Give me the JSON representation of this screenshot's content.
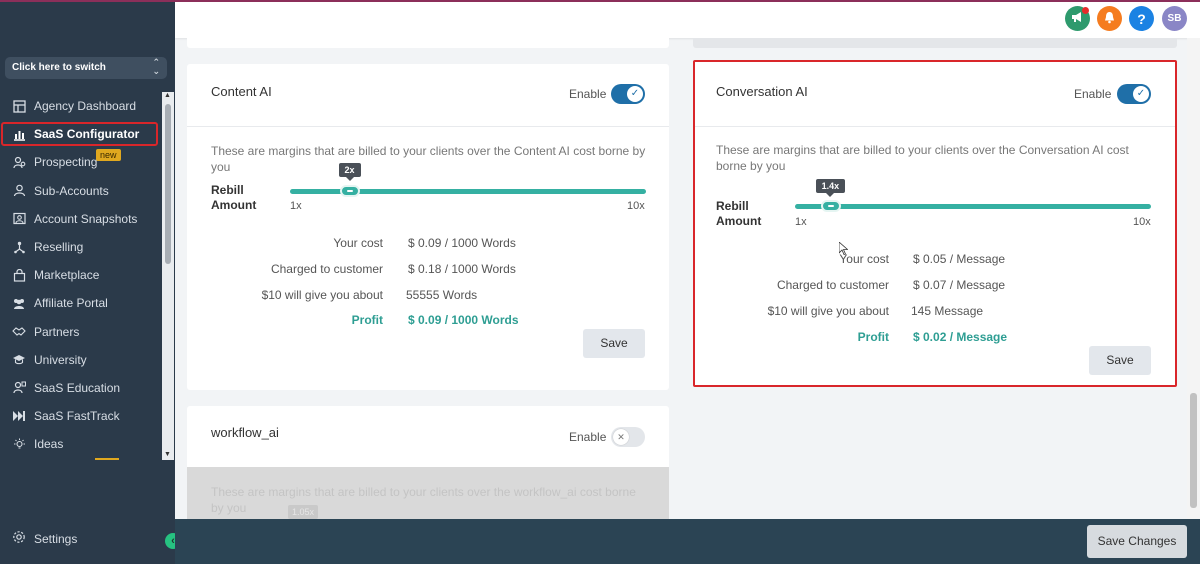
{
  "sidebar": {
    "switcher_label": "Click here to switch",
    "items": [
      {
        "label": "Agency Dashboard",
        "icon": "dashboard-icon"
      },
      {
        "label": "SaaS Configurator",
        "icon": "chart-icon",
        "active": true
      },
      {
        "label": "Prospecting",
        "icon": "person-search-icon",
        "badge": "new"
      },
      {
        "label": "Sub-Accounts",
        "icon": "user-icon"
      },
      {
        "label": "Account Snapshots",
        "icon": "snapshot-icon"
      },
      {
        "label": "Reselling",
        "icon": "reselling-icon"
      },
      {
        "label": "Marketplace",
        "icon": "bag-icon"
      },
      {
        "label": "Affiliate Portal",
        "icon": "users-icon"
      },
      {
        "label": "Partners",
        "icon": "handshake-icon"
      },
      {
        "label": "University",
        "icon": "graduation-icon"
      },
      {
        "label": "SaaS Education",
        "icon": "education-icon"
      },
      {
        "label": "SaaS FastTrack",
        "icon": "fast-forward-icon"
      },
      {
        "label": "Ideas",
        "icon": "lightbulb-icon"
      }
    ],
    "settings_label": "Settings"
  },
  "header": {
    "avatar_initials": "SB",
    "help_glyph": "?"
  },
  "cards": {
    "content_ai": {
      "title": "Content AI",
      "enable_label": "Enable",
      "enabled": true,
      "description": "These are margins that are billed to your clients over the Content AI cost borne by you",
      "rebill_label_1": "Rebill",
      "rebill_label_2": "Amount",
      "slider_value": "2x",
      "slider_fraction": 0.111,
      "min_label": "1x",
      "max_label": "10x",
      "your_cost_label": "Your cost",
      "your_cost_value": "$  0.09 / 1000 Words",
      "charged_label": "Charged to customer",
      "charged_value": "$ 0.18 / 1000 Words",
      "ten_label": "$10 will give you about",
      "ten_value": "55555 Words",
      "profit_label": "Profit",
      "profit_value": "$ 0.09 / 1000 Words",
      "save_label": "Save"
    },
    "conversation_ai": {
      "title": "Conversation AI",
      "enable_label": "Enable",
      "enabled": true,
      "description": "These are margins that are billed to your clients over the Conversation AI cost borne by you",
      "rebill_label_1": "Rebill",
      "rebill_label_2": "Amount",
      "slider_value": "1.4x",
      "slider_fraction": 0.044,
      "min_label": "1x",
      "max_label": "10x",
      "your_cost_label": "Your cost",
      "your_cost_value": "$  0.05 / Message",
      "charged_label": "Charged to customer",
      "charged_value": "$ 0.07 / Message",
      "ten_label": "$10 will give you about",
      "ten_value": "145 Message",
      "profit_label": "Profit",
      "profit_value": "$ 0.02 / Message",
      "save_label": "Save"
    },
    "workflow_ai": {
      "title": "workflow_ai",
      "enable_label": "Enable",
      "enabled": false,
      "description": "These are margins that are billed to your clients over the workflow_ai cost borne by you",
      "slider_value": "1.05x"
    }
  },
  "footer": {
    "save_changes_label": "Save Changes"
  },
  "colors": {
    "sidebar_bg": "#2b3a4a",
    "accent_teal": "#35b0a2",
    "toggle_on": "#1f6fa8",
    "highlight_red": "#d9262a",
    "footer_bg": "#2b4454"
  }
}
